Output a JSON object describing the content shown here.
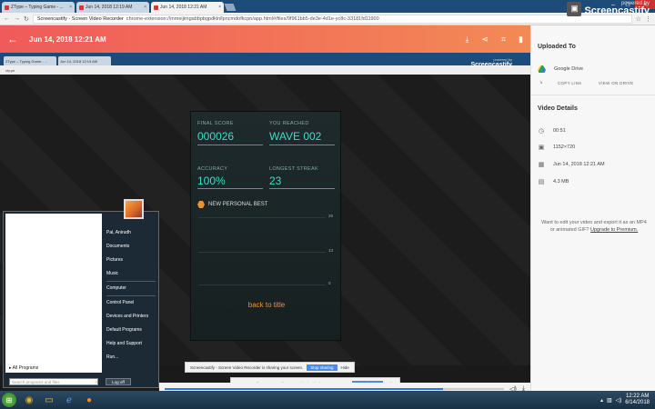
{
  "browser": {
    "tabs": [
      {
        "label": "ZType – Typing Game - ..."
      },
      {
        "label": "Jun 14, 2018 12:19 AM"
      },
      {
        "label": "Jun 14, 2018 12:21 AM"
      },
      {
        "label": "Screencastify - Screen Video Recorder"
      }
    ],
    "url_host": "Screencastify - Screen Video Recorder",
    "url_path": "chrome-extension://mmeijimgabbpbgpdklnllpncmdofkcpn/app.html#/files/9f961bb5-de3e-4d1e-yc8c-33181fd11900"
  },
  "watermark": {
    "small": "powered by",
    "brand": "Screencastify"
  },
  "header": {
    "date": "Jun 14, 2018 12:21 AM"
  },
  "video": {
    "inner_url": "zty.pe",
    "watermark_small": "powered by",
    "watermark_brand": "Screencastify",
    "game": {
      "final_score_label": "FINAL SCORE",
      "final_score": "000026",
      "reached_label": "YOU REACHED",
      "reached": "WAVE 002",
      "accuracy_label": "ACCURACY",
      "accuracy": "100%",
      "streak_label": "LONGEST STREAK",
      "streak": "23",
      "best_label": "NEW PERSONAL BEST",
      "axis": [
        "26",
        "13",
        "0"
      ],
      "back_label": "back to title"
    },
    "sharing_text": "Screencastify - Screen Video Recorder is sharing your screen.",
    "stop_label": "Stop sharing",
    "hide_label": "Hide"
  },
  "startmenu": {
    "all_programs": "All Programs",
    "search_placeholder": "Search programs and files",
    "shutdown": "Log off",
    "items": [
      "Pal, Anirudh",
      "Documents",
      "Pictures",
      "Music",
      "Computer",
      "Control Panel",
      "Devices and Printers",
      "Default Programs",
      "Help and Support",
      "Run..."
    ]
  },
  "taskbar": {
    "time": "12:22 AM",
    "date": "6/14/2018"
  },
  "panel": {
    "uploaded_title": "Uploaded To",
    "drive_label": "Google Drive",
    "copy_link": "COPY LINK",
    "view_on_drive": "VIEW ON DRIVE",
    "details_title": "Video Details",
    "duration": "00:51",
    "resolution": "1152×720",
    "date": "Jun 14, 2018 12:21 AM",
    "size": "4.3 MB",
    "upsell_text": "Want to edit your video and export it as an MP4 or animated GIF? ",
    "upsell_link": "Upgrade to Premium."
  }
}
